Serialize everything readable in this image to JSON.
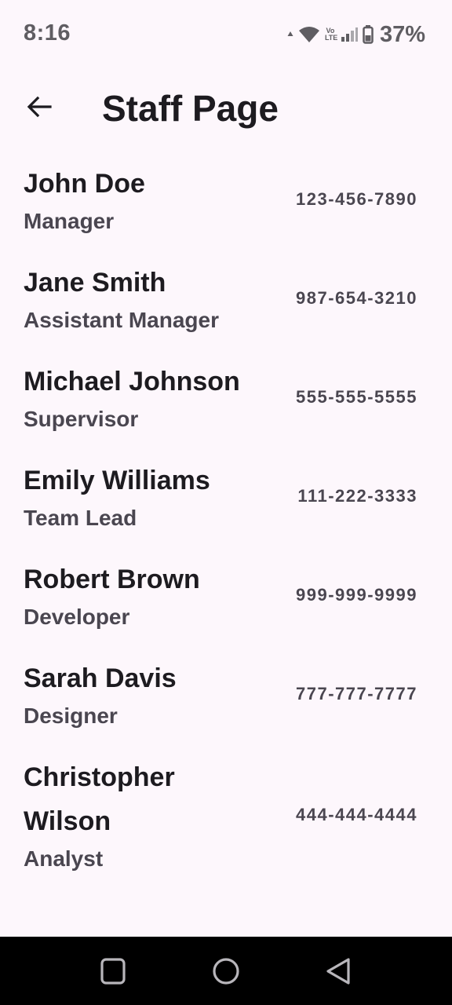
{
  "status_bar": {
    "time": "8:16",
    "battery_percent": "37%",
    "icons": [
      "upload-arrow-icon",
      "wifi-icon",
      "volte-icon",
      "signal-icon",
      "battery-icon"
    ],
    "volte_top": "Vo",
    "volte_bottom": "LTE"
  },
  "app_bar": {
    "back_icon": "arrow-left-icon",
    "title": "Staff Page"
  },
  "staff": [
    {
      "name": "John Doe",
      "role": "Manager",
      "phone": "123-456-7890"
    },
    {
      "name": "Jane Smith",
      "role": "Assistant Manager",
      "phone": "987-654-3210"
    },
    {
      "name": "Michael Johnson",
      "role": "Supervisor",
      "phone": "555-555-5555"
    },
    {
      "name": "Emily Williams",
      "role": "Team Lead",
      "phone": "111-222-3333"
    },
    {
      "name": "Robert Brown",
      "role": "Developer",
      "phone": "999-999-9999"
    },
    {
      "name": "Sarah Davis",
      "role": "Designer",
      "phone": "777-777-7777"
    },
    {
      "name": "Christopher Wilson",
      "role": "Analyst",
      "phone": "444-444-4444"
    }
  ],
  "nav_bar": {
    "icons": [
      "recents-square-icon",
      "home-circle-icon",
      "back-triangle-icon"
    ]
  },
  "colors": {
    "background": "#fdf7fc",
    "text_primary": "#1d1b20",
    "text_secondary": "#4a4650",
    "nav_bar": "#000000"
  }
}
